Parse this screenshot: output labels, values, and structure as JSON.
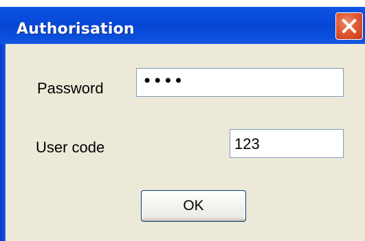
{
  "window": {
    "title": "Authorisation",
    "close_icon": "close-icon"
  },
  "form": {
    "password_label": "Password",
    "password_value": "••••",
    "user_code_label": "User code",
    "user_code_value": "123"
  },
  "buttons": {
    "ok_label": "OK"
  },
  "colors": {
    "titlebar": "#0a4fe0",
    "client_background": "#ece9d8",
    "close_button": "#e05a34",
    "field_border": "#7f9db9"
  }
}
